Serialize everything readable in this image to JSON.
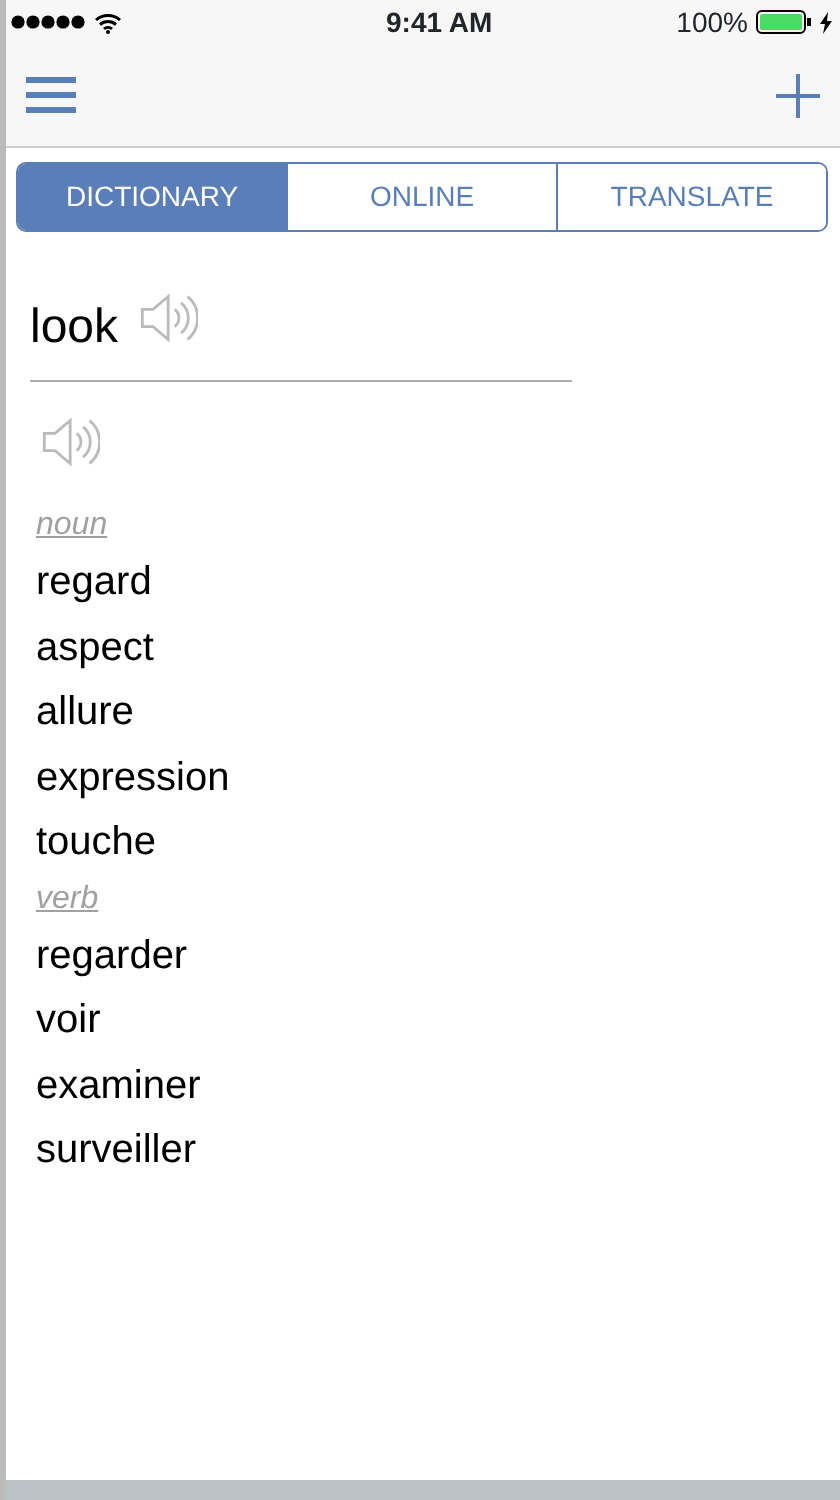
{
  "status_bar": {
    "time": "9:41 AM",
    "battery": "100%"
  },
  "tabs": [
    {
      "label": "DICTIONARY",
      "selected": true
    },
    {
      "label": "ONLINE",
      "selected": false
    },
    {
      "label": "TRANSLATE",
      "selected": false
    }
  ],
  "entry": {
    "headword": "look",
    "sections": [
      {
        "part_of_speech": "noun",
        "translations": [
          "regard",
          "aspect",
          "allure",
          "expression",
          "touche"
        ]
      },
      {
        "part_of_speech": "verb",
        "translations": [
          "regarder",
          "voir",
          "examiner",
          "surveiller"
        ]
      }
    ]
  }
}
